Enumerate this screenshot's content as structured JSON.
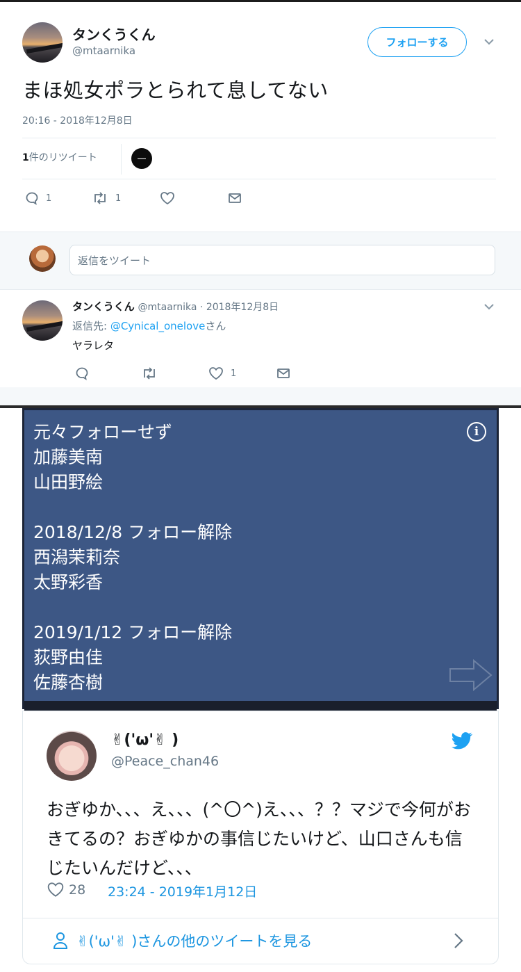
{
  "tweet": {
    "display_name": "タンくうくん",
    "handle": "@mtaarnika",
    "follow_label": "フォローする",
    "text": "まほ処女ポラとられて息してない",
    "timestamp": "20:16 - 2018年12月8日",
    "retweet_count": "1",
    "retweet_label": "件のリツイート",
    "actions": {
      "reply": "1",
      "retweet": "1"
    }
  },
  "reply_box": {
    "placeholder": "返信をツイート"
  },
  "reply": {
    "display_name": "タンくうくん",
    "meta": "@mtaarnika · 2018年12月8日",
    "reply_prefix": "返信先: ",
    "reply_to": "@Cynical_onelove",
    "reply_suffix": "さん",
    "text": "ヤラレタ",
    "actions": {
      "like": "1"
    }
  },
  "blue_card": {
    "lines": [
      "元々フォローせず",
      "加藤美南",
      "山田野絵",
      "2018/12/8 フォロー解除",
      "西潟茉莉奈",
      "太野彩香",
      "2019/1/12 フォロー解除",
      "荻野由佳",
      "佐藤杏樹"
    ]
  },
  "embedded": {
    "display_name": "✌('ω'✌ )",
    "handle": "@Peace_chan46",
    "text": "おぎゆか、、、え、、、(^〇^)え、、、？？マジで今何がおきてるの？おぎゆかの事信じたいけど、山口さんも信じたいんだけど、、、",
    "likes": "28",
    "timestamp": "23:24 - 2019年1月12日",
    "more_link": "✌('ω'✌ )さんの他のツイートを見る"
  },
  "colors": {
    "accent": "#1da1f2",
    "blue_card": "#3d5785",
    "muted": "#657786"
  }
}
